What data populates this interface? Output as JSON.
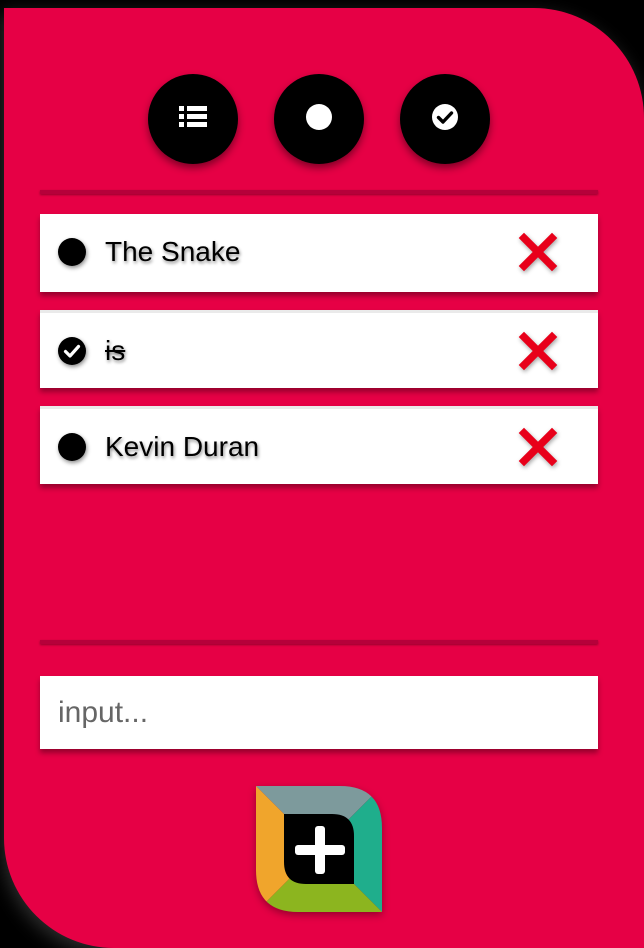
{
  "filters": [
    {
      "name": "all",
      "icon": "list-icon"
    },
    {
      "name": "active",
      "icon": "circle-icon"
    },
    {
      "name": "completed",
      "icon": "check-circle-icon"
    }
  ],
  "todos": [
    {
      "text": "The Snake",
      "completed": false
    },
    {
      "text": "is",
      "completed": true
    },
    {
      "text": "Kevin Duran",
      "completed": false
    }
  ],
  "input": {
    "placeholder": "input...",
    "value": ""
  },
  "icons": {
    "filter_all": "list-icon",
    "filter_active": "circle-icon",
    "filter_completed": "check-circle-icon",
    "pending": "circle-icon",
    "done": "check-circle-icon",
    "delete": "close-icon",
    "add": "plus-icon"
  },
  "colors": {
    "background": "#e60045",
    "divider": "#b6003a",
    "delete": "#e8001a",
    "add_top": "#7d9a9c",
    "add_right": "#1fae8c",
    "add_bottom": "#8cb51f",
    "add_left": "#f0a52c"
  }
}
